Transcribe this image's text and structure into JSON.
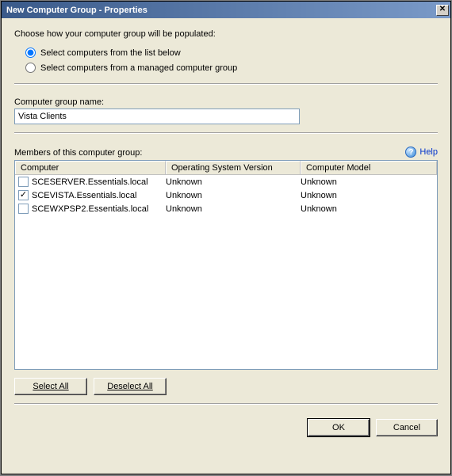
{
  "window": {
    "title": "New Computer Group - Properties"
  },
  "instruction": "Choose how your computer group will be populated:",
  "radios": {
    "from_list": {
      "label": "Select computers from the list below",
      "checked": true
    },
    "from_managed": {
      "label": "Select computers from a managed computer group",
      "checked": false
    }
  },
  "group_name": {
    "label": "Computer group name:",
    "value": "Vista Clients"
  },
  "members_label": "Members of this computer group:",
  "help": {
    "label": "Help"
  },
  "columns": {
    "computer": "Computer",
    "osv": "Operating System Version",
    "model": "Computer Model"
  },
  "rows": [
    {
      "checked": false,
      "computer": "SCESERVER.Essentials.local",
      "osv": "Unknown",
      "model": "Unknown"
    },
    {
      "checked": true,
      "computer": "SCEVISTA.Essentials.local",
      "osv": "Unknown",
      "model": "Unknown"
    },
    {
      "checked": false,
      "computer": "SCEWXPSP2.Essentials.local",
      "osv": "Unknown",
      "model": "Unknown"
    }
  ],
  "buttons": {
    "select_all": "Select All",
    "deselect_all": "Deselect All",
    "ok": "OK",
    "cancel": "Cancel"
  }
}
